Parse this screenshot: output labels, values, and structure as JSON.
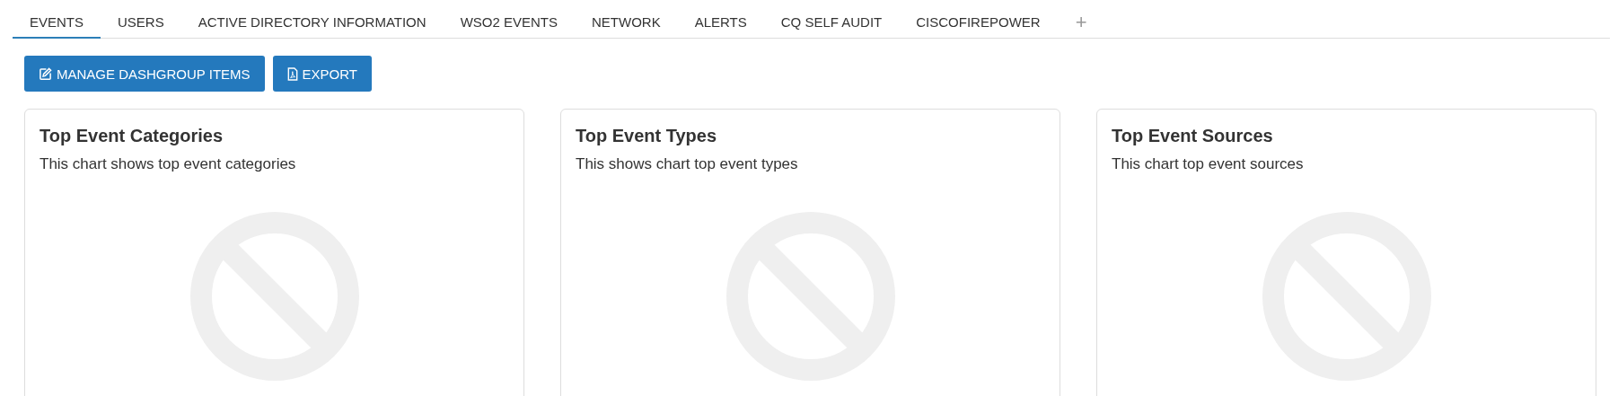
{
  "tabs": [
    {
      "label": "EVENTS",
      "selected": true
    },
    {
      "label": "USERS",
      "selected": false
    },
    {
      "label": "ACTIVE DIRECTORY INFORMATION",
      "selected": false
    },
    {
      "label": "WSO2 EVENTS",
      "selected": false
    },
    {
      "label": "NETWORK",
      "selected": false
    },
    {
      "label": "ALERTS",
      "selected": false
    },
    {
      "label": "CQ SELF AUDIT",
      "selected": false
    },
    {
      "label": "CISCOFIREPOWER",
      "selected": false
    }
  ],
  "add_tab": "+",
  "buttons": [
    {
      "kind": "edit",
      "label": "MANAGE DASHGROUP ITEMS"
    },
    {
      "kind": "pdf",
      "label": "EXPORT"
    }
  ],
  "cards": [
    {
      "title": "Top Event Categories",
      "description": "This chart shows top event categories"
    },
    {
      "title": "Top Event Types",
      "description": "This shows chart top event types"
    },
    {
      "title": "Top Event Sources",
      "description": "This chart top event sources"
    }
  ]
}
